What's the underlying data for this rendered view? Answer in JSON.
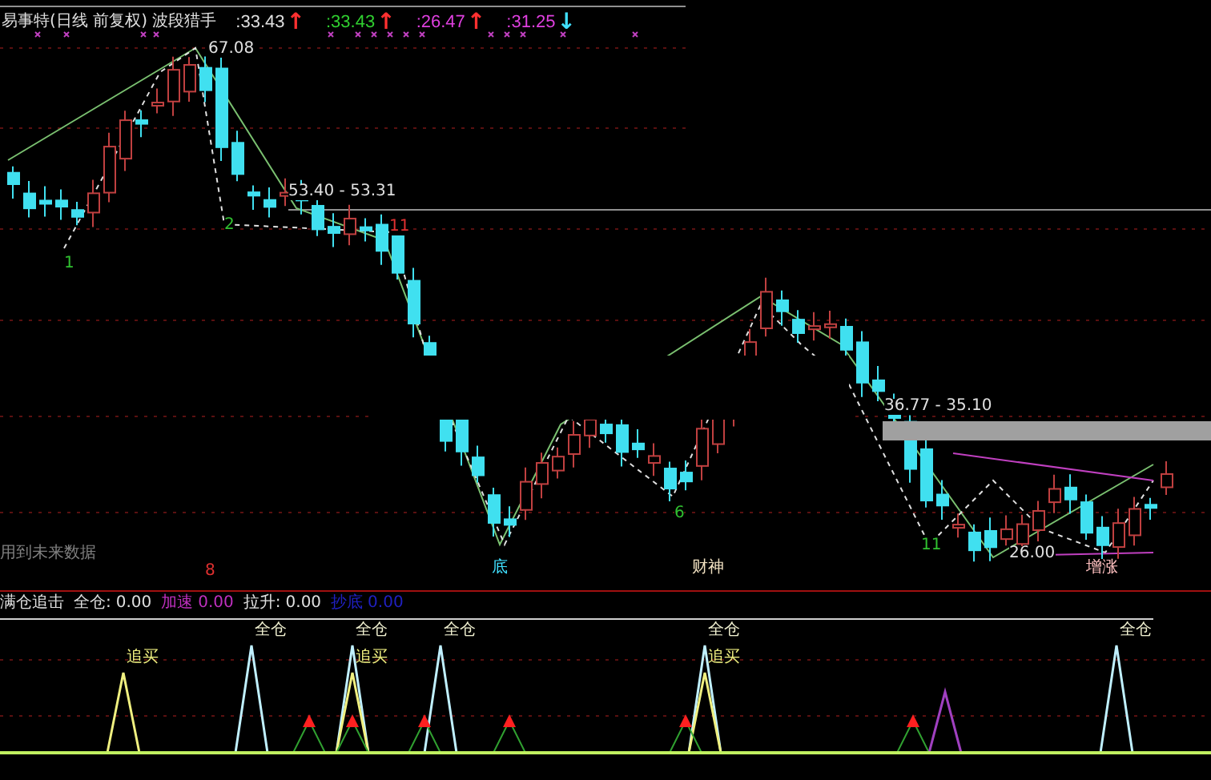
{
  "header": {
    "title": "易事特(日线 前复权) 波段猎手",
    "values": [
      {
        "text": ":33.43",
        "color": "#e0e0e0",
        "arrow": {
          "text": "↑",
          "color": "#ff3030"
        }
      },
      {
        "text": ":33.43",
        "color": "#30d030",
        "arrow": {
          "text": "↑",
          "color": "#ff3030"
        }
      },
      {
        "text": ":26.47",
        "color": "#e040e0",
        "arrow": {
          "text": "↑",
          "color": "#ff3030"
        }
      },
      {
        "text": ":31.25",
        "color": "#e040e0",
        "arrow": {
          "text": "↓",
          "color": "#40e0ff"
        }
      }
    ]
  },
  "chart_labels": [
    {
      "text": "67.08",
      "color": "#e0e0e0"
    },
    {
      "text": "1",
      "color": "#30c030"
    },
    {
      "text": "2",
      "color": "#30c030"
    },
    {
      "text": "53.40 - 53.31",
      "color": "#e0e0e0"
    },
    {
      "text": "11",
      "color": "#e03030"
    },
    {
      "text": "36.77 - 35.10",
      "color": "#e0e0e0"
    },
    {
      "text": "6",
      "color": "#30c030"
    },
    {
      "text": "11",
      "color": "#30c030"
    },
    {
      "text": "26.00",
      "color": "#e0e0e0"
    },
    {
      "text": "用到未来数据",
      "color": "#808080"
    },
    {
      "text": "8",
      "color": "#e03030"
    },
    {
      "text": "底",
      "color": "#40e0ff"
    },
    {
      "text": "财神",
      "color": "#f0e0c0"
    },
    {
      "text": "增涨",
      "color": "#ffc0c0"
    }
  ],
  "indicator": {
    "title": "满仓追击",
    "fields": [
      {
        "label": "全仓:",
        "value": "0.00",
        "color": "#e0e0e0"
      },
      {
        "label": "加速",
        "value": "0.00",
        "color": "#c030c0"
      },
      {
        "label": "拉升:",
        "value": "0.00",
        "color": "#e0e0e0"
      },
      {
        "label": "抄底",
        "value": "0.00",
        "color": "#2020c0"
      }
    ],
    "signals": [
      {
        "text": "追买",
        "kind": "chase"
      },
      {
        "text": "全仓",
        "kind": "full"
      },
      {
        "text": "全仓",
        "kind": "full"
      },
      {
        "text": "追买",
        "kind": "chase"
      },
      {
        "text": "全仓",
        "kind": "full"
      },
      {
        "text": "全仓",
        "kind": "full"
      },
      {
        "text": "追买",
        "kind": "chase"
      },
      {
        "text": "全仓",
        "kind": "full"
      }
    ]
  }
}
